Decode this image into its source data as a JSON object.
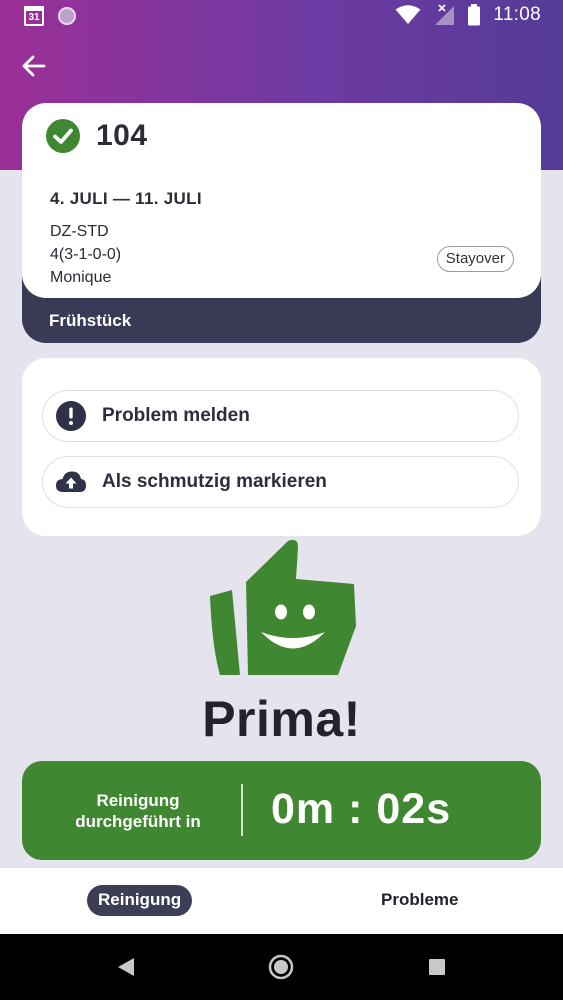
{
  "status_bar": {
    "calendar_day": "31",
    "time": "11:08",
    "icons": [
      "calendar-icon",
      "app-circle-icon",
      "wifi-icon",
      "signal-icon",
      "battery-icon"
    ]
  },
  "header": {
    "back_icon": "arrow-left-icon"
  },
  "room": {
    "number": "104",
    "status_icon": "check-circle-icon",
    "dates": "4. JULI — 11. JULI",
    "type": "DZ-STD",
    "occupancy": "4(3-1-0-0)",
    "guest": "Monique",
    "badge": "Stayover",
    "meal": "Frühstück"
  },
  "actions": {
    "report_problem": "Problem melden",
    "report_problem_icon": "exclamation-circle-icon",
    "mark_dirty": "Als schmutzig markieren",
    "mark_dirty_icon": "cloud-upload-icon"
  },
  "result": {
    "mascot_icon": "thumbs-up-smile-icon",
    "message": "Prima!"
  },
  "timer": {
    "label_line1": "Reinigung",
    "label_line2": "durchgeführt in",
    "value": "0m : 02s"
  },
  "bottom_nav": {
    "cleaning": "Reinigung",
    "problems": "Probleme",
    "active": "Reinigung"
  },
  "colors": {
    "gradient_start": "#9b2f97",
    "gradient_end": "#553b97",
    "dark_navy": "#383a56",
    "success_green": "#3f8730",
    "background": "#e4e3ee"
  }
}
